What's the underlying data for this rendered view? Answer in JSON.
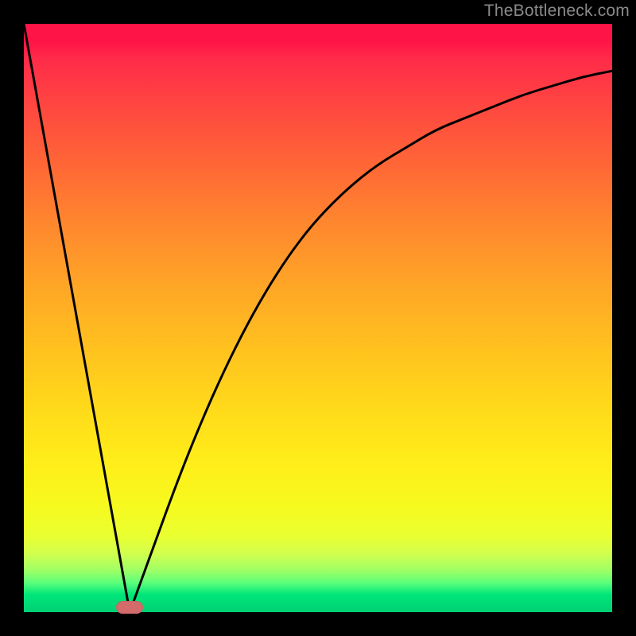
{
  "watermark": "TheBottleneck.com",
  "chart_data": {
    "type": "line",
    "title": "",
    "xlabel": "",
    "ylabel": "",
    "xlim": [
      0,
      100
    ],
    "ylim": [
      0,
      100
    ],
    "grid": false,
    "legend": false,
    "series": [
      {
        "name": "descent",
        "x": [
          0,
          18
        ],
        "y": [
          100,
          0
        ]
      },
      {
        "name": "ascent",
        "x": [
          18,
          22,
          26,
          30,
          34,
          38,
          42,
          46,
          50,
          55,
          60,
          65,
          70,
          75,
          80,
          85,
          90,
          95,
          100
        ],
        "y": [
          0,
          11,
          22,
          32,
          41,
          49,
          56,
          62,
          67,
          72,
          76,
          79,
          82,
          84,
          86,
          88,
          89.5,
          91,
          92
        ]
      }
    ],
    "marker": {
      "x": 18,
      "y": 0,
      "color": "#d36b6b"
    }
  }
}
